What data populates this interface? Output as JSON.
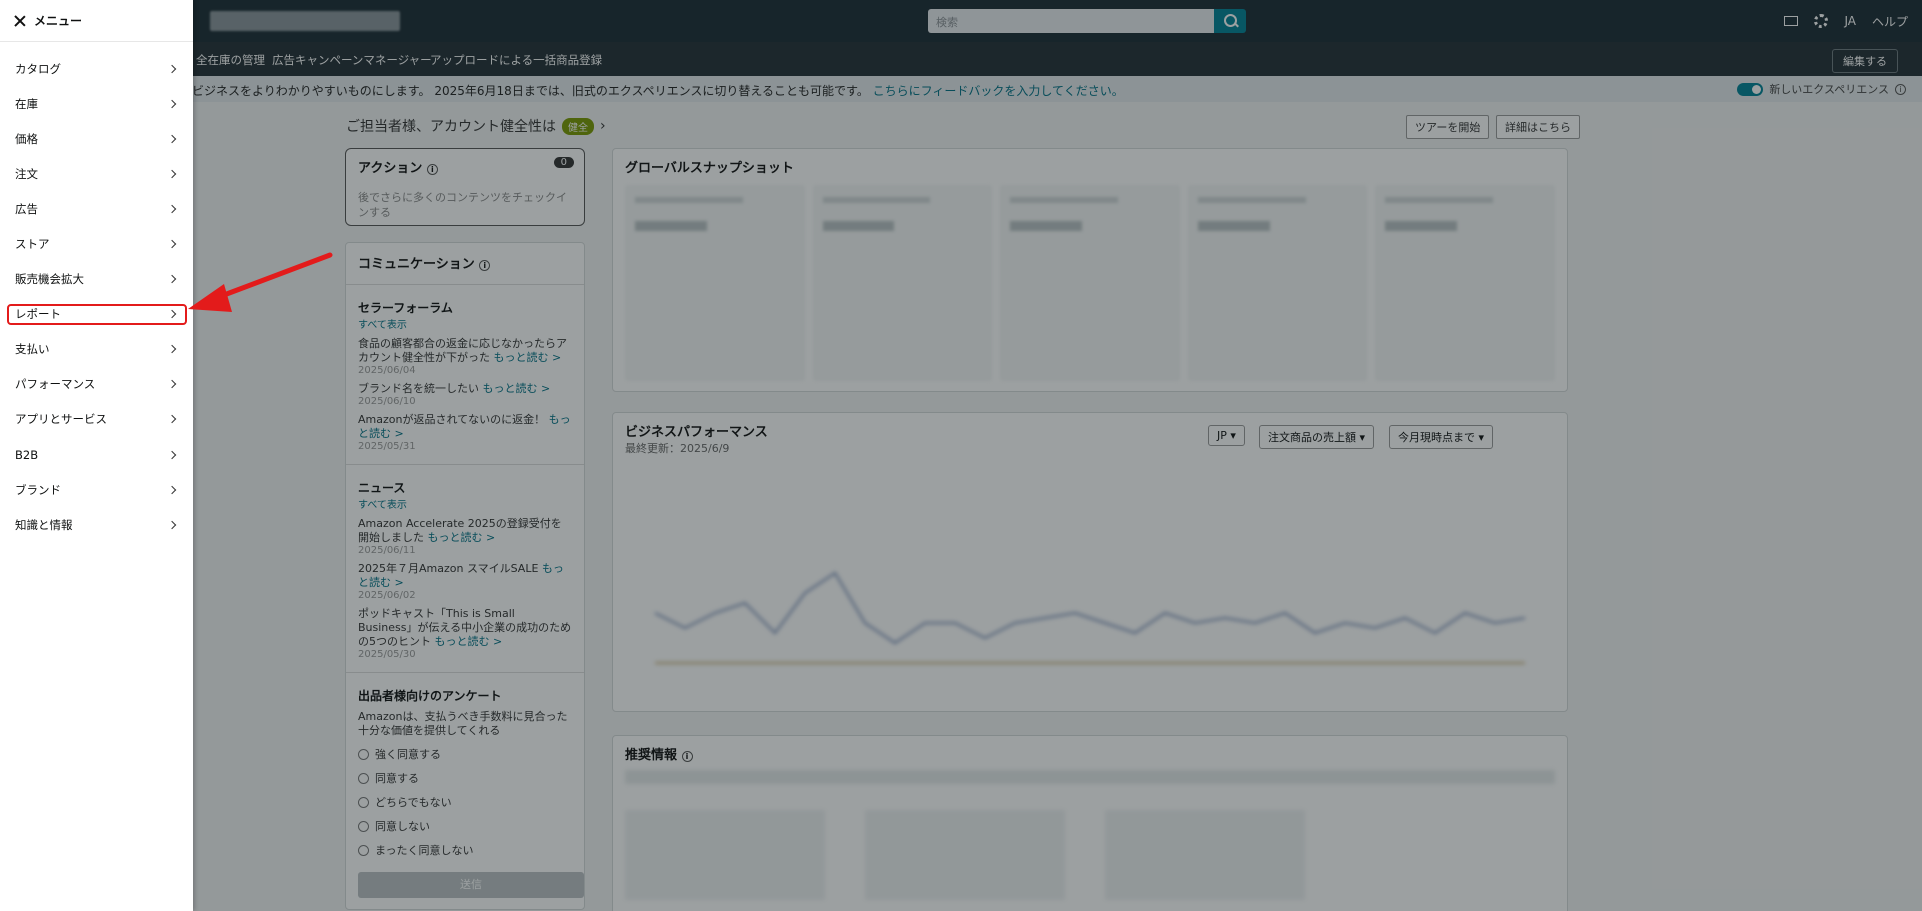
{
  "topbar": {
    "search_placeholder": "検索",
    "language": "JA",
    "help": "ヘルプ"
  },
  "subnav": {
    "items": [
      "全在庫の管理",
      "広告キャンペーンマネージャー",
      "アップロードによる一括商品登録"
    ],
    "edit": "編集する"
  },
  "banner": {
    "text": "ビジネスをよりわかりやすいものにします。 2025年6月18日までは、旧式のエクスペリエンスに切り替えることも可能です。",
    "link": "こちらにフィードバックを入力してください。",
    "toggle_label": "新しいエクスペリエンス"
  },
  "dashboard": {
    "greeting": "ご担当者様、アカウント健全性は",
    "health_badge": "健全",
    "tour_button": "ツアーを開始",
    "details_button": "詳細はこちら",
    "action": {
      "title": "アクション",
      "count": "0",
      "body": "後でさらに多くのコンテンツをチェックインする"
    },
    "communication": {
      "title": "コミュニケーション",
      "forum": {
        "title": "セラーフォーラム",
        "show_all": "すべて表示",
        "items": [
          {
            "text": "食品の顧客都合の返金に応じなかったらアカウント健全性が下がった",
            "more": "もっと読む >",
            "date": "2025/06/04"
          },
          {
            "text": "ブランド名を統一したい",
            "more": "もっと読む >",
            "date": "2025/06/10"
          },
          {
            "text": "Amazonが返品されてないのに返金！",
            "more": "もっと読む >",
            "date": "2025/05/31"
          }
        ]
      },
      "news": {
        "title": "ニュース",
        "show_all": "すべて表示",
        "items": [
          {
            "text": "Amazon Accelerate 2025の登録受付を開始しました",
            "more": "もっと読む >",
            "date": "2025/06/11"
          },
          {
            "text": "2025年７月Amazon スマイルSALE",
            "more": "もっと読む >",
            "date": "2025/06/02"
          },
          {
            "text": "ポッドキャスト「This is Small Business」が伝える中小企業の成功のための5つのヒント",
            "more": "もっと読む >",
            "date": "2025/05/30"
          }
        ]
      },
      "survey": {
        "title": "出品者様向けのアンケート",
        "question": "Amazonは、支払うべき手数料に見合った十分な価値を提供してくれる",
        "options": [
          "強く同意する",
          "同意する",
          "どちらでもない",
          "同意しない",
          "まったく同意しない"
        ],
        "submit": "送信"
      }
    },
    "snapshot": {
      "title": "グローバルスナップショット"
    },
    "business": {
      "title": "ビジネスパフォーマンス",
      "updated": "最終更新：2025/6/9",
      "marketplace": "JP",
      "metric": "注文商品の売上額",
      "period": "今月現時点まで"
    },
    "recommendations": {
      "title": "推奨情報"
    }
  },
  "menu": {
    "title": "メニュー",
    "items": [
      {
        "label": "カタログ"
      },
      {
        "label": "在庫"
      },
      {
        "label": "価格"
      },
      {
        "label": "注文"
      },
      {
        "label": "広告"
      },
      {
        "label": "ストア"
      },
      {
        "label": "販売機会拡大"
      },
      {
        "label": "レポート"
      },
      {
        "label": "支払い"
      },
      {
        "label": "パフォーマンス"
      },
      {
        "label": "アプリとサービス"
      },
      {
        "label": "B2B"
      },
      {
        "label": "ブランド"
      },
      {
        "label": "知識と情報"
      }
    ],
    "highlighted_item": "レポート"
  },
  "colors": {
    "accent": "#008296",
    "highlight": "#e31b1b",
    "arrow": "#e31b1b"
  }
}
